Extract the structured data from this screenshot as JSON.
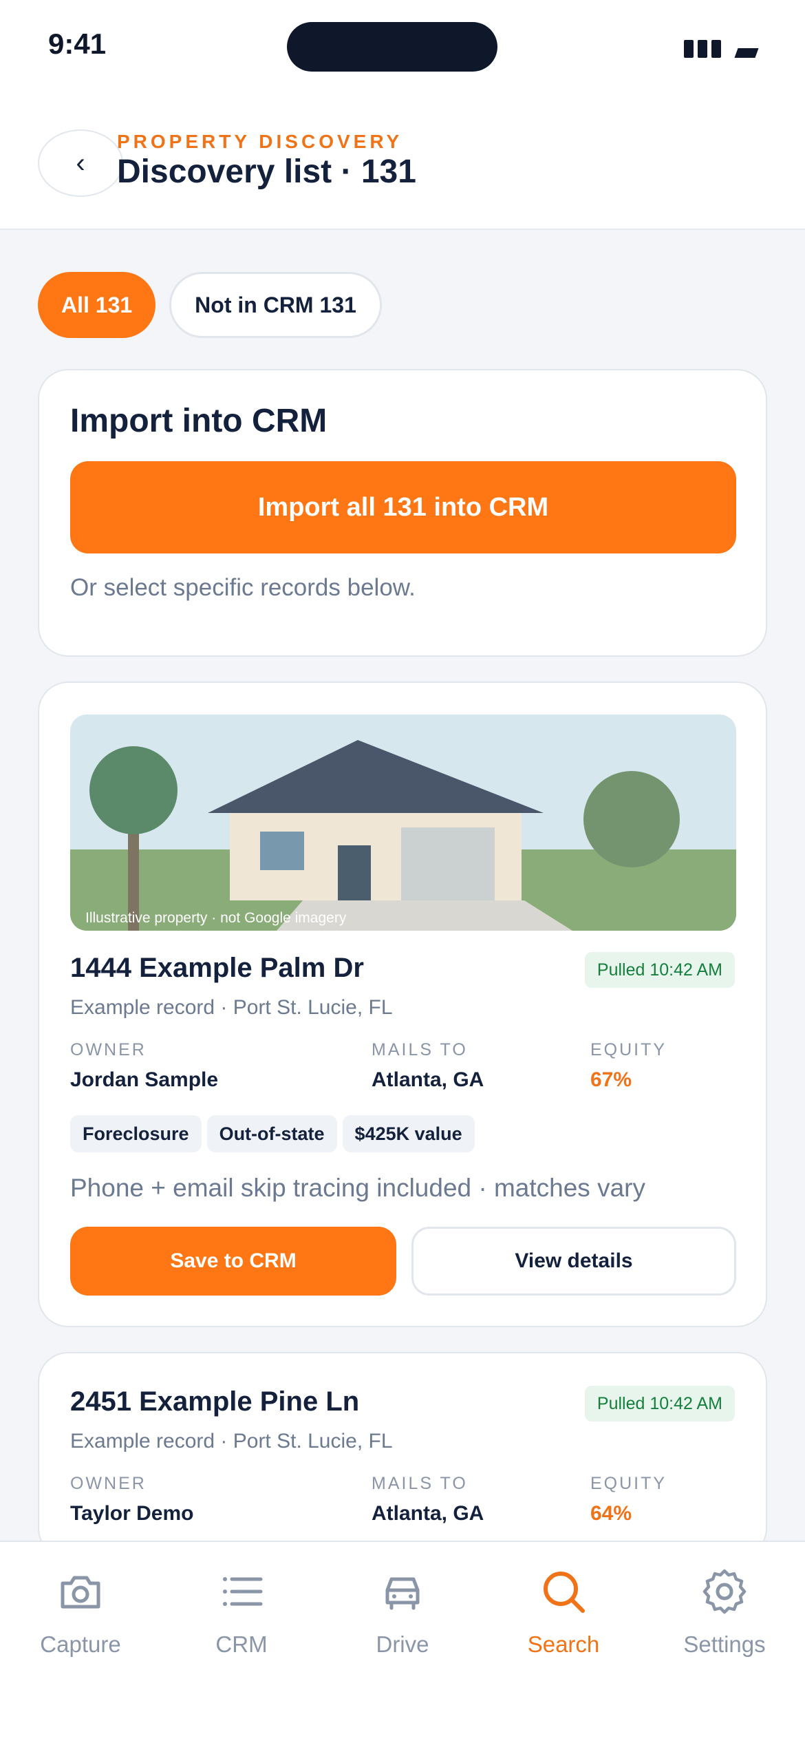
{
  "status_bar": {
    "time": "9:41"
  },
  "header": {
    "eyebrow": "PROPERTY DISCOVERY",
    "title": "Discovery list · 131",
    "back_icon": "chevron-left-icon"
  },
  "filters": [
    {
      "label": "All 131",
      "active": true
    },
    {
      "label": "Not in CRM 131",
      "active": false
    }
  ],
  "import_card": {
    "title": "Import into CRM",
    "button_label": "Import all 131 into CRM",
    "hint": "Or select specific records below."
  },
  "properties": [
    {
      "image_caption": "Illustrative property · not Google imagery",
      "address": "1444 Example Palm Dr",
      "subaddress": "Example record · Port St. Lucie, FL",
      "pulled": "Pulled 10:42 AM",
      "owner_label": "OWNER",
      "owner": "Jordan Sample",
      "mails_label": "MAILS TO",
      "mails_to": "Atlanta, GA",
      "equity_label": "EQUITY",
      "equity": "67%",
      "tags": [
        "Foreclosure",
        "Out-of-state",
        "$425K value"
      ],
      "note": "Phone + email skip tracing included · matches vary",
      "save_label": "Save to CRM",
      "view_label": "View details"
    },
    {
      "address": "2451 Example Pine Ln",
      "subaddress": "Example record · Port St. Lucie, FL",
      "pulled": "Pulled 10:42 AM",
      "owner_label": "OWNER",
      "owner": "Taylor Demo",
      "mails_label": "MAILS TO",
      "mails_to": "Atlanta, GA",
      "equity_label": "EQUITY",
      "equity": "64%"
    }
  ],
  "tabbar": [
    {
      "label": "Capture",
      "icon": "camera-icon",
      "active": false
    },
    {
      "label": "CRM",
      "icon": "list-icon",
      "active": false
    },
    {
      "label": "Drive",
      "icon": "car-icon",
      "active": false
    },
    {
      "label": "Search",
      "icon": "search-icon",
      "active": true
    },
    {
      "label": "Settings",
      "icon": "gear-icon",
      "active": false
    }
  ],
  "colors": {
    "accent": "#ff7614",
    "text": "#14213d",
    "muted": "#6b7a90",
    "success_bg": "#e7f5ec",
    "success_text": "#15803d"
  }
}
